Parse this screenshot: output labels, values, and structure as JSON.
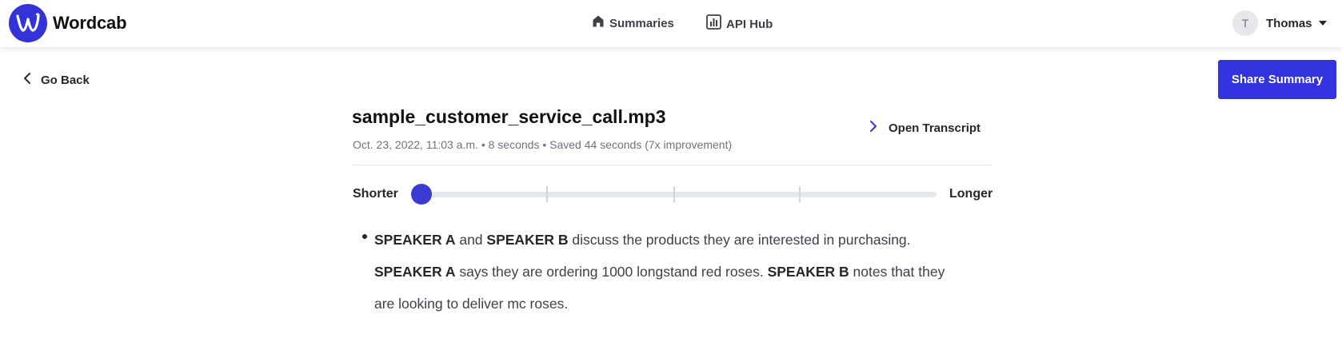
{
  "header": {
    "brand": "Wordcab",
    "nav": [
      {
        "label": "Summaries",
        "icon": "home-icon"
      },
      {
        "label": "API Hub",
        "icon": "bar-chart-icon"
      }
    ],
    "user": {
      "initial": "T",
      "name": "Thomas"
    }
  },
  "toolbar": {
    "back_label": "Go Back",
    "share_label": "Share Summary"
  },
  "file": {
    "title": "sample_customer_service_call.mp3",
    "meta": "Oct. 23, 2022, 11:03 a.m. • 8 seconds • Saved 44 seconds (7x improvement)",
    "open_transcript_label": "Open Transcript"
  },
  "length_slider": {
    "min_label": "Shorter",
    "max_label": "Longer",
    "steps": 5,
    "selected_step": 1
  },
  "summary": {
    "segments": [
      {
        "text": "SPEAKER A",
        "bold": true
      },
      {
        "text": " and ",
        "bold": false
      },
      {
        "text": "SPEAKER B",
        "bold": true
      },
      {
        "text": " discuss the products they are interested in purchasing. ",
        "bold": false
      },
      {
        "text": "SPEAKER A",
        "bold": true
      },
      {
        "text": " says they are ordering 1000 longstand red roses. ",
        "bold": false
      },
      {
        "text": "SPEAKER B",
        "bold": true
      },
      {
        "text": " notes that they are looking to deliver mc roses.",
        "bold": false
      }
    ]
  },
  "colors": {
    "accent": "#3333e0",
    "slider_thumb": "#3b3bd1"
  }
}
